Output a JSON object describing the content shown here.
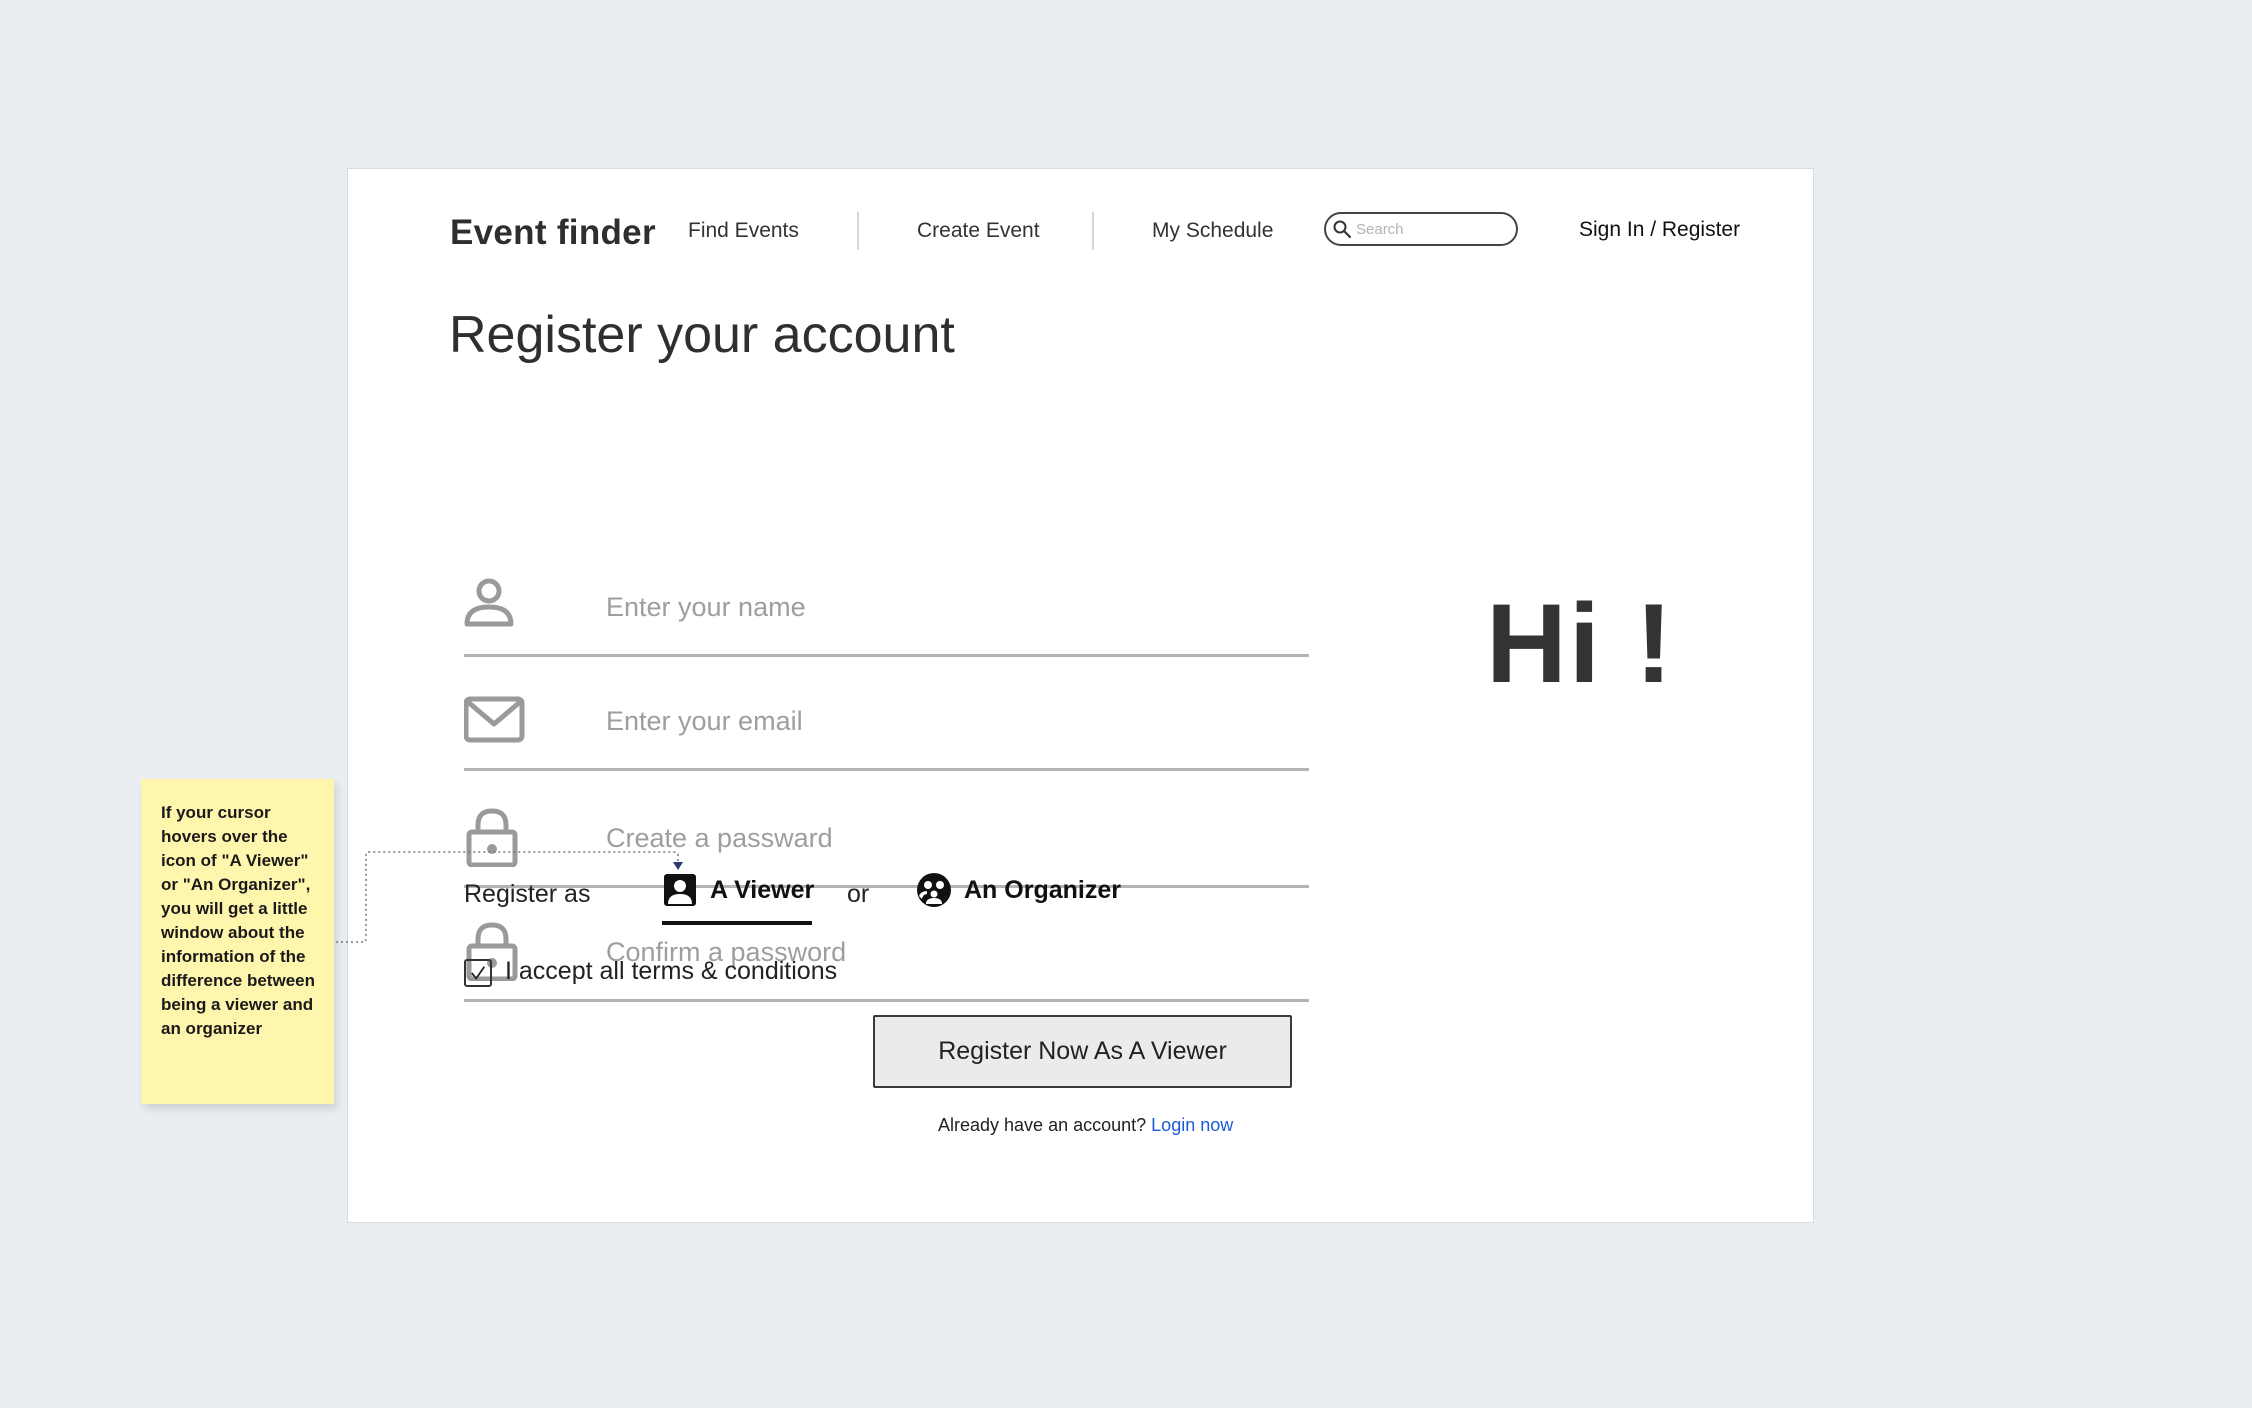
{
  "header": {
    "logo": "Event finder",
    "nav": [
      {
        "label": "Find Events"
      },
      {
        "label": "Create Event"
      },
      {
        "label": "My Schedule"
      }
    ],
    "search_placeholder": "Search",
    "signin": "Sign In / Register"
  },
  "title": "Register your account",
  "fields": [
    {
      "icon": "person-icon",
      "placeholder": "Enter your name"
    },
    {
      "icon": "envelope-icon",
      "placeholder": "Enter your email"
    },
    {
      "icon": "lock-icon",
      "placeholder": "Create a passward"
    },
    {
      "icon": "lock-icon",
      "placeholder": "Confirm a password"
    }
  ],
  "register_as": {
    "label": "Register as",
    "viewer": "A Viewer",
    "or": "or",
    "organizer": "An Organizer",
    "selected": "A Viewer"
  },
  "terms": {
    "checked": true,
    "label": "I accept all terms & conditions"
  },
  "register_button": "Register Now As A Viewer",
  "login_prompt": {
    "text": "Already have an account?",
    "link": "Login now"
  },
  "greeting": "Hi !",
  "note": "If your cursor hovers over the icon of \"A Viewer\" or \"An Organizer\", you will get a little window about the information of the difference between being a viewer and an organizer",
  "colors": {
    "background": "#eaedf2",
    "note": "#fff6ad",
    "link": "#1a5bd6",
    "button": "#ebebeb"
  }
}
